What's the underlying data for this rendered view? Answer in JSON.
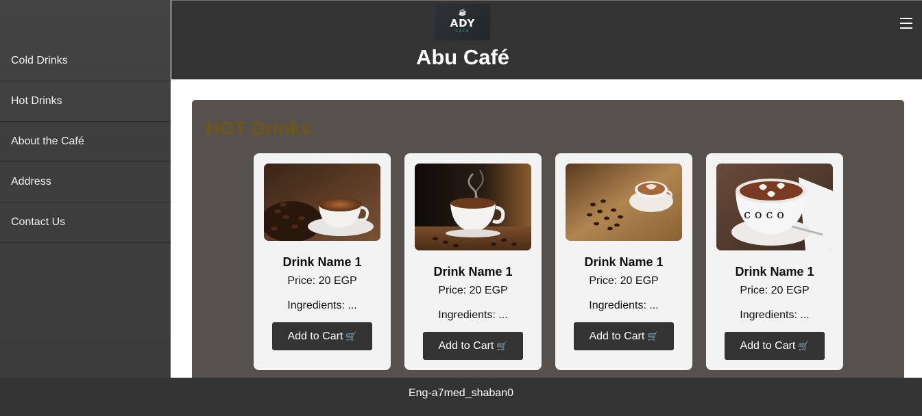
{
  "sidebar": {
    "items": [
      {
        "label": "Cold Drinks"
      },
      {
        "label": "Hot Drinks"
      },
      {
        "label": "About the Café"
      },
      {
        "label": "Address"
      },
      {
        "label": "Contact Us"
      }
    ]
  },
  "header": {
    "logo_text": "ADY",
    "logo_subtext": "CAFE",
    "title": "Abu Café",
    "menu_icon": "hamburger-menu-icon"
  },
  "section": {
    "heading": "HOT Drinks",
    "heading_color": "#6e5616"
  },
  "products": [
    {
      "name": "Drink Name 1",
      "price": "Price: 20 EGP",
      "ingredients": "Ingredients: ...",
      "button_label": "Add to Cart",
      "image": "coffee-cup-with-beans-photo"
    },
    {
      "name": "Drink Name 1",
      "price": "Price: 20 EGP",
      "ingredients": "Ingredients: ...",
      "button_label": "Add to Cart",
      "image": "steaming-coffee-cup-photo"
    },
    {
      "name": "Drink Name 1",
      "price": "Price: 20 EGP",
      "ingredients": "Ingredients: ...",
      "button_label": "Add to Cart",
      "image": "latte-art-on-burlap-photo"
    },
    {
      "name": "Drink Name 1",
      "price": "Price: 20 EGP",
      "ingredients": "Ingredients: ...",
      "button_label": "Add to Cart",
      "image": "cocoa-heart-latte-photo"
    }
  ],
  "footer": {
    "text": "Eng-a7med_shaban0"
  },
  "colors": {
    "header_bg": "#333333",
    "sidebar_bg": "#3e3e3e",
    "section_bg": "#56514d",
    "card_bg": "#f3f3f3",
    "button_bg": "#333333"
  }
}
